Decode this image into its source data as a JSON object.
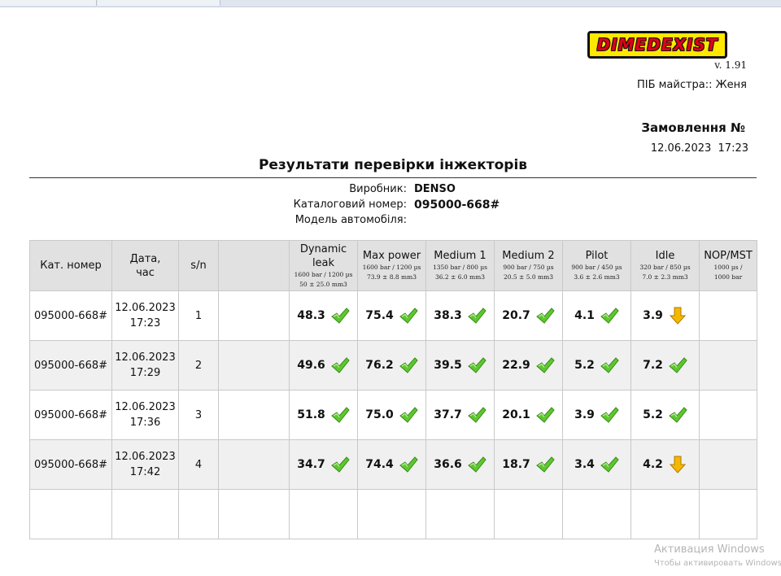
{
  "header": {
    "logo_text": "DIMEDEXIST",
    "version": "v. 1.91",
    "master_label": "ПІБ майстра:: Женя",
    "order_label": "Замовлення №",
    "order_date": "12.06.2023",
    "order_time": "17:23"
  },
  "report": {
    "title": "Результати перевірки інжекторів",
    "manufacturer_label": "Виробник:",
    "manufacturer_value": "DENSO",
    "catalog_label": "Каталоговий номер:",
    "catalog_value": "095000-668#",
    "model_label": "Модель автомобіля:"
  },
  "table": {
    "columns": [
      {
        "title": "Кат. номер"
      },
      {
        "title_line1": "Дата,",
        "title_line2": "час"
      },
      {
        "title": "s/n"
      },
      {
        "title": ""
      },
      {
        "title": "Dynamic leak",
        "sub1": "1600 bar / 1200 µs",
        "sub2": "50 ± 25.0 mm3"
      },
      {
        "title": "Max power",
        "sub1": "1600 bar / 1200 µs",
        "sub2": "73.9 ± 8.8 mm3"
      },
      {
        "title": "Medium 1",
        "sub1": "1350 bar / 800 µs",
        "sub2": "36.2 ± 6.0 mm3"
      },
      {
        "title": "Medium 2",
        "sub1": "900 bar / 750 µs",
        "sub2": "20.5 ± 5.0 mm3"
      },
      {
        "title": "Pilot",
        "sub1": "900 bar / 450 µs",
        "sub2": "3.6 ± 2.6 mm3"
      },
      {
        "title": "Idle",
        "sub1": "320 bar / 850 µs",
        "sub2": "7.0 ± 2.3 mm3"
      },
      {
        "title": "NOP/MST",
        "sub1": "1000 µs /",
        "sub2": "1000 bar"
      }
    ],
    "rows": [
      {
        "cat": "095000-668#",
        "date": "12.06.2023",
        "time": "17:23",
        "sn": "1",
        "values": [
          [
            "48.3",
            "check"
          ],
          [
            "75.4",
            "check"
          ],
          [
            "38.3",
            "check"
          ],
          [
            "20.7",
            "check"
          ],
          [
            "4.1",
            "check"
          ],
          [
            "3.9",
            "arrow-down"
          ]
        ]
      },
      {
        "cat": "095000-668#",
        "date": "12.06.2023",
        "time": "17:29",
        "sn": "2",
        "values": [
          [
            "49.6",
            "check"
          ],
          [
            "76.2",
            "check"
          ],
          [
            "39.5",
            "check"
          ],
          [
            "22.9",
            "check"
          ],
          [
            "5.2",
            "check"
          ],
          [
            "7.2",
            "check"
          ]
        ]
      },
      {
        "cat": "095000-668#",
        "date": "12.06.2023",
        "time": "17:36",
        "sn": "3",
        "values": [
          [
            "51.8",
            "check"
          ],
          [
            "75.0",
            "check"
          ],
          [
            "37.7",
            "check"
          ],
          [
            "20.1",
            "check"
          ],
          [
            "3.9",
            "check"
          ],
          [
            "5.2",
            "check"
          ]
        ]
      },
      {
        "cat": "095000-668#",
        "date": "12.06.2023",
        "time": "17:42",
        "sn": "4",
        "values": [
          [
            "34.7",
            "check"
          ],
          [
            "74.4",
            "check"
          ],
          [
            "36.6",
            "check"
          ],
          [
            "18.7",
            "check"
          ],
          [
            "3.4",
            "check"
          ],
          [
            "4.2",
            "arrow-down"
          ]
        ]
      }
    ]
  },
  "status_colors": {
    "pass": "#5cc82e",
    "warn": "#f5b800"
  },
  "watermark": {
    "line1": "Активация Windows",
    "line2": "Чтобы активировать Windows,"
  }
}
